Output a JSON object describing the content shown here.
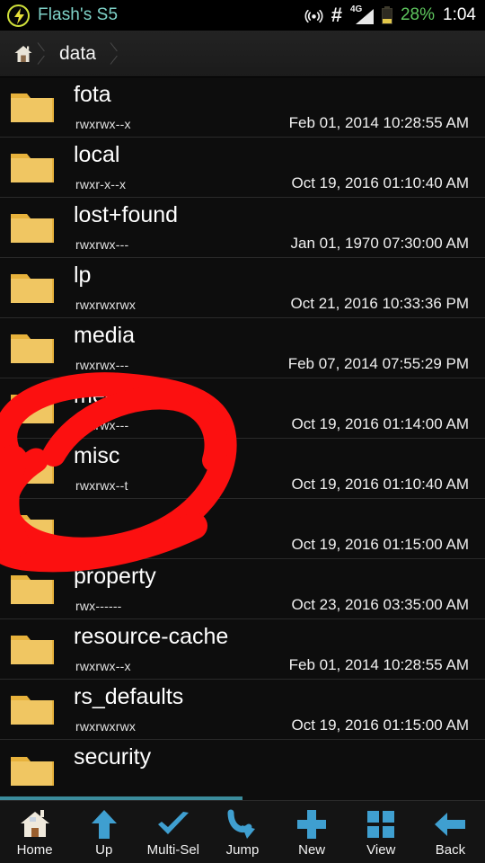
{
  "status_bar": {
    "app_icon": "lightning-bolt-icon",
    "title": "Flash's S5",
    "icons": [
      "hotspot-icon",
      "hash-icon",
      "signal-icon",
      "battery-icon"
    ],
    "network_type": "4G",
    "battery_percent": "28%",
    "clock": "1:04",
    "colors": {
      "title": "#7fd3c9",
      "battery_text": "#5ec65e",
      "clock": "#ffffff",
      "bolt": "#cfe03a"
    }
  },
  "breadcrumb": {
    "home_icon": "home-icon",
    "path": [
      {
        "label": "data"
      }
    ]
  },
  "file_list": {
    "rows": [
      {
        "name": "fota",
        "perm": "rwxrwx--x",
        "date": "Feb 01, 2014 10:28:55 AM",
        "icon": "folder-icon"
      },
      {
        "name": "local",
        "perm": "rwxr-x--x",
        "date": "Oct 19, 2016 01:10:40 AM",
        "icon": "folder-icon"
      },
      {
        "name": "lost+found",
        "perm": "rwxrwx---",
        "date": "Jan 01, 1970 07:30:00 AM",
        "icon": "folder-icon"
      },
      {
        "name": "lp",
        "perm": "rwxrwxrwx",
        "date": "Oct 21, 2016 10:33:36 PM",
        "icon": "folder-icon"
      },
      {
        "name": "media",
        "perm": "rwxrwx---",
        "date": "Feb 07, 2014 07:55:29 PM",
        "icon": "folder-icon"
      },
      {
        "name": "mediadrm",
        "perm": "rwxrwx---",
        "date": "Oct 19, 2016 01:14:00 AM",
        "icon": "folder-icon"
      },
      {
        "name": "misc",
        "perm": "rwxrwx--t",
        "date": "Oct 19, 2016 01:10:40 AM",
        "icon": "folder-icon"
      },
      {
        "name": "",
        "perm": "",
        "date": "Oct 19, 2016 01:15:00 AM",
        "icon": "folder-icon"
      },
      {
        "name": "property",
        "perm": "rwx------",
        "date": "Oct 23, 2016 03:35:00 AM",
        "icon": "folder-icon"
      },
      {
        "name": "resource-cache",
        "perm": "rwxrwx--x",
        "date": "Feb 01, 2014 10:28:55 AM",
        "icon": "folder-icon"
      },
      {
        "name": "rs_defaults",
        "perm": "rwxrwxrwx",
        "date": "Oct 19, 2016 01:15:00 AM",
        "icon": "folder-icon"
      },
      {
        "name": "security",
        "perm": "",
        "date": "",
        "icon": "folder-icon"
      }
    ],
    "scroll_indicator_color": "#3b8c9c"
  },
  "annotation": {
    "type": "hand-drawn-circle",
    "color": "#fc1010",
    "target": "misc"
  },
  "toolbar": {
    "items": [
      {
        "label": "Home",
        "icon": "house-icon"
      },
      {
        "label": "Up",
        "icon": "arrow-up-icon"
      },
      {
        "label": "Multi-Sel",
        "icon": "checkmark-icon"
      },
      {
        "label": "Jump",
        "icon": "curved-arrow-icon"
      },
      {
        "label": "New",
        "icon": "plus-icon"
      },
      {
        "label": "View",
        "icon": "grid-icon"
      },
      {
        "label": "Back",
        "icon": "arrow-left-icon"
      }
    ],
    "accent_color": "#3f9fd0"
  }
}
